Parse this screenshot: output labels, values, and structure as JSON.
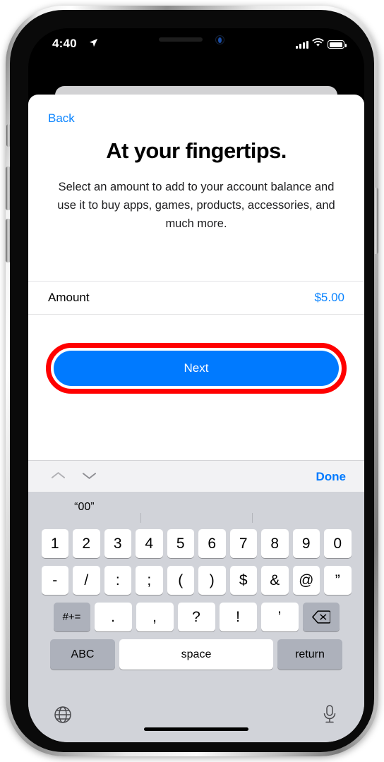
{
  "status_bar": {
    "time": "4:40",
    "location_icon": "location-arrow-icon",
    "signal_icon": "cellular-signal-icon",
    "signal_bars": 4,
    "wifi_icon": "wifi-icon",
    "battery_icon": "battery-full-icon"
  },
  "sheet": {
    "back_label": "Back",
    "title": "At your fingertips.",
    "subtitle": "Select an amount to add to your account balance and use it to buy apps, games, products, accessories, and much more.",
    "amount_row": {
      "label": "Amount",
      "value": "$5.00"
    },
    "next_label": "Next"
  },
  "annotation": {
    "highlight_color": "#ff0000",
    "target": "next-button"
  },
  "keyboard": {
    "accessory": {
      "prev_icon": "chevron-up-icon",
      "next_icon": "chevron-down-icon",
      "done_label": "Done"
    },
    "predictive": [
      "“00”",
      "",
      ""
    ],
    "rows": {
      "numbers": [
        "1",
        "2",
        "3",
        "4",
        "5",
        "6",
        "7",
        "8",
        "9",
        "0"
      ],
      "symbols": [
        "-",
        "/",
        ":",
        ";",
        "(",
        ")",
        "$",
        "&",
        "@",
        "”"
      ],
      "punct_shift": "#+=",
      "punct": [
        ".",
        ",",
        "?",
        "!",
        "’"
      ],
      "delete_icon": "delete-backspace-icon",
      "bottom": {
        "abc_label": "ABC",
        "space_label": "space",
        "return_label": "return"
      }
    },
    "bottom_bar": {
      "globe_icon": "globe-icon",
      "mic_icon": "microphone-icon"
    }
  },
  "colors": {
    "accent_blue": "#007aff",
    "link_blue": "#0a84ff",
    "annotation_red": "#ff0000",
    "keyboard_bg": "#d1d3d9"
  }
}
